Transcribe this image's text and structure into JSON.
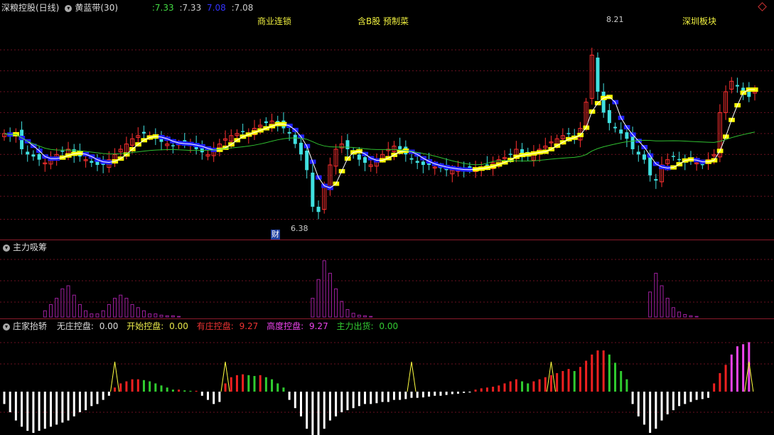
{
  "main": {
    "stock_name": "深粮控股(日线)",
    "indicator_name": "黄蓝带(30)",
    "values": [
      ":7.33",
      ":7.33",
      "7.08",
      ":7.08"
    ],
    "value_colors": [
      "#44dd44",
      "#cccccc",
      "#3333ff",
      "#cccccc"
    ],
    "annotations": [
      "商业连锁",
      "含B股 预制菜",
      "深圳板块"
    ],
    "high_label": "8.21",
    "low_label": "6.38",
    "finance_tag": "财"
  },
  "panel1": {
    "name": "主力吸筹"
  },
  "panel2": {
    "name": "庄家抬轿",
    "items": [
      {
        "label": "无庄控盘:",
        "value": "0.00",
        "color": "#dddddd"
      },
      {
        "label": "开始控盘:",
        "value": "0.00",
        "color": "#e8e84a"
      },
      {
        "label": "有庄控盘:",
        "value": "9.27",
        "color": "#ee3333"
      },
      {
        "label": "高度控盘:",
        "value": "9.27",
        "color": "#ee44ee"
      },
      {
        "label": "主力出货:",
        "value": "0.00",
        "color": "#33cc33"
      }
    ]
  },
  "colors": {
    "up": "#ff3030",
    "down": "#40e0e0",
    "yellow_band": "#ffff00",
    "blue_band": "#2020ff",
    "ma_green": "#30c030",
    "ma_white": "#ffffff",
    "grid": "#6a1020",
    "accumulation": "#a020a0"
  },
  "chart_data": [
    {
      "type": "candlestick",
      "title": "深粮控股(日线)",
      "ylim": [
        6.2,
        8.3
      ],
      "y_gridlines": [
        6.38,
        6.6,
        6.8,
        7.0,
        7.2,
        7.4,
        7.6,
        7.8,
        8.0
      ],
      "high": 8.21,
      "low": 6.38,
      "close": [
        7.2,
        7.18,
        7.2,
        7.05,
        7.0,
        6.98,
        6.95,
        6.92,
        6.95,
        7.0,
        7.03,
        7.05,
        7.0,
        6.98,
        6.95,
        6.92,
        6.9,
        6.9,
        6.95,
        7.0,
        7.05,
        7.1,
        7.15,
        7.18,
        7.2,
        7.18,
        7.15,
        7.12,
        7.1,
        7.08,
        7.1,
        7.12,
        7.1,
        7.05,
        7.02,
        7.0,
        7.05,
        7.1,
        7.15,
        7.18,
        7.2,
        7.22,
        7.2,
        7.25,
        7.28,
        7.3,
        7.32,
        7.3,
        7.25,
        7.2,
        7.1,
        7.0,
        6.85,
        6.5,
        6.45,
        6.7,
        6.9,
        7.05,
        7.1,
        7.05,
        7.0,
        6.95,
        6.92,
        6.9,
        6.95,
        7.0,
        7.05,
        7.08,
        7.05,
        7.0,
        6.95,
        6.92,
        6.9,
        6.9,
        6.88,
        6.87,
        6.85,
        6.85,
        6.86,
        6.85,
        6.86,
        6.87,
        6.88,
        6.9,
        6.92,
        6.95,
        6.97,
        7.0,
        7.05,
        7.0,
        6.98,
        7.02,
        7.05,
        7.08,
        7.12,
        7.15,
        7.18,
        7.2,
        7.15,
        7.25,
        7.5,
        7.95,
        7.6,
        7.4,
        7.3,
        7.25,
        7.2,
        7.15,
        7.05,
        7.0,
        6.95,
        6.8,
        6.75,
        6.9,
        6.95,
        6.98,
        6.95,
        6.93,
        6.95,
        6.92,
        6.9,
        6.95,
        7.0,
        7.4,
        7.6,
        7.7,
        7.65,
        7.6,
        7.55,
        7.6
      ]
    },
    {
      "type": "bar",
      "title": "主力吸筹",
      "series": [
        {
          "values": [
            0,
            0,
            0,
            0,
            0,
            0,
            0,
            0.1,
            0.2,
            0.3,
            0.45,
            0.5,
            0.35,
            0.2,
            0.1,
            0.05,
            0.05,
            0.1,
            0.2,
            0.3,
            0.35,
            0.3,
            0.2,
            0.15,
            0.1,
            0.05,
            0.05,
            0.03,
            0.02,
            0.02,
            0.01,
            0,
            0,
            0,
            0,
            0,
            0,
            0,
            0,
            0,
            0,
            0,
            0,
            0,
            0,
            0,
            0,
            0,
            0,
            0,
            0,
            0,
            0,
            0.3,
            0.6,
            0.9,
            0.7,
            0.45,
            0.25,
            0.12,
            0.06,
            0.03,
            0.02,
            0.01,
            0,
            0,
            0,
            0,
            0,
            0,
            0,
            0,
            0,
            0,
            0,
            0,
            0,
            0,
            0,
            0,
            0,
            0,
            0,
            0,
            0,
            0,
            0,
            0,
            0,
            0,
            0,
            0,
            0,
            0,
            0,
            0,
            0,
            0,
            0,
            0,
            0,
            0,
            0,
            0,
            0,
            0,
            0,
            0,
            0,
            0,
            0,
            0.4,
            0.7,
            0.5,
            0.3,
            0.15,
            0.08,
            0.04,
            0.02,
            0.01,
            0,
            0,
            0,
            0,
            0,
            0,
            0,
            0,
            0,
            0,
            0
          ]
        }
      ]
    },
    {
      "type": "bar",
      "title": "庄家抬轿",
      "series": [
        {
          "values": [
            -0.3,
            -0.5,
            -0.7,
            -0.85,
            -0.95,
            -1.0,
            -0.95,
            -0.9,
            -0.85,
            -0.8,
            -0.75,
            -0.7,
            -0.6,
            -0.5,
            -0.45,
            -0.35,
            -0.3,
            -0.2,
            -0.1,
            0.1,
            0.2,
            0.25,
            0.3,
            0.3,
            0.28,
            0.25,
            0.2,
            0.15,
            0.1,
            0.05,
            0.05,
            0.03,
            0.02,
            0.02,
            -0.1,
            -0.2,
            -0.3,
            -0.25,
            0.2,
            0.35,
            0.4,
            0.42,
            0.4,
            0.38,
            0.4,
            0.35,
            0.3,
            0.2,
            0.1,
            -0.2,
            -0.4,
            -0.6,
            -0.9,
            -1.05,
            -1.1,
            -0.9,
            -0.7,
            -0.6,
            -0.5,
            -0.45,
            -0.4,
            -0.35,
            -0.3,
            -0.3,
            -0.28,
            -0.25,
            -0.25,
            -0.2,
            -0.2,
            -0.18,
            -0.15,
            -0.15,
            -0.14,
            -0.12,
            -0.1,
            -0.1,
            -0.08,
            -0.06,
            -0.05,
            -0.03,
            -0.02,
            0.05,
            0.08,
            0.1,
            0.12,
            0.15,
            0.2,
            0.25,
            0.3,
            0.25,
            0.2,
            0.25,
            0.3,
            0.35,
            0.4,
            0.45,
            0.5,
            0.55,
            0.5,
            0.6,
            0.75,
            0.9,
            1.0,
            1.0,
            0.9,
            0.7,
            0.5,
            0.3,
            -0.3,
            -0.6,
            -0.8,
            -1.0,
            -0.9,
            -0.7,
            -0.55,
            -0.45,
            -0.35,
            -0.3,
            -0.25,
            -0.2,
            -0.18,
            -0.15,
            0.2,
            0.45,
            0.65,
            0.9,
            1.1,
            1.15,
            1.2
          ]
        }
      ]
    }
  ]
}
